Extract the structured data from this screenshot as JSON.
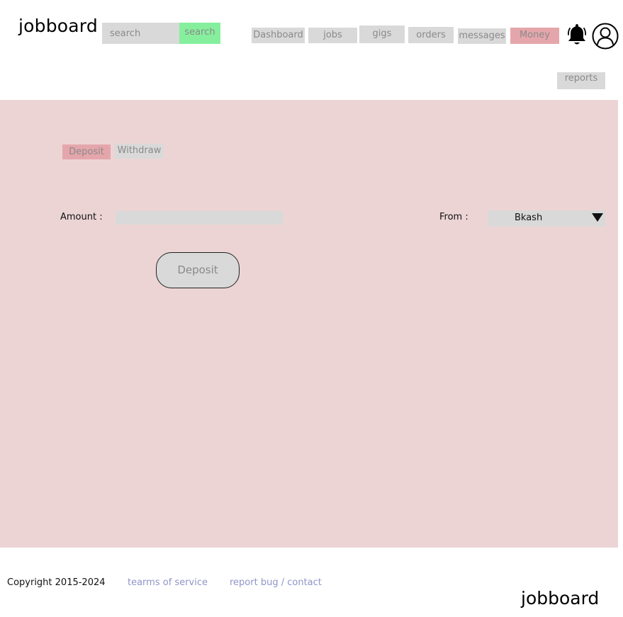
{
  "header": {
    "logo": "jobboard",
    "search": {
      "placeholder": "search",
      "value": "",
      "button_label": "search"
    },
    "nav": [
      {
        "label": "Dashboard",
        "active": false
      },
      {
        "label": "jobs",
        "active": false
      },
      {
        "label": "gigs",
        "active": false
      },
      {
        "label": "orders",
        "active": false
      },
      {
        "label": "messages",
        "active": false
      },
      {
        "label": "Money",
        "active": true
      },
      {
        "label": "reports",
        "active": false
      }
    ],
    "icons": {
      "notifications": "bell-icon",
      "profile": "user-icon"
    }
  },
  "money": {
    "tabs": [
      {
        "label": "Deposit",
        "active": true
      },
      {
        "label": "Withdraw",
        "active": false
      }
    ],
    "form": {
      "amount_label": "Amount :",
      "amount_value": "",
      "from_label": "From :",
      "from_selected": "Bkash",
      "submit_label": "Deposit"
    }
  },
  "footer": {
    "copyright": "Copyright 2015-2024",
    "terms_label": "tearms of service",
    "report_label": "report bug / contact",
    "logo": "jobboard"
  },
  "colors": {
    "accent_active": "#e5a6ab",
    "search_button": "#86ef9d",
    "content_bg": "#ecd4d5",
    "link": "#8f95c8",
    "inactive": "#d9d9d9"
  }
}
